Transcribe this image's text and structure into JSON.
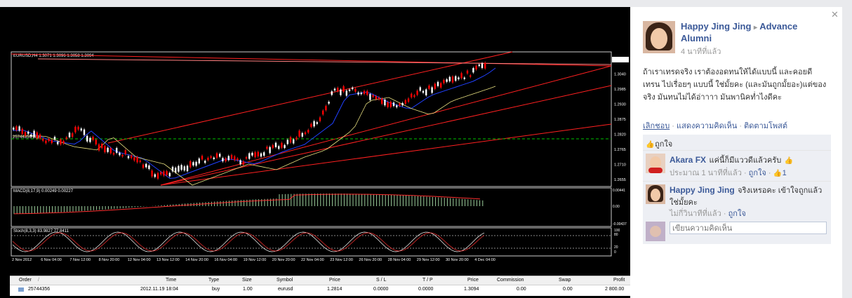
{
  "chart": {
    "symbol_header": "EURUSD,H4  1.3071 1.3096 1.3058 1.3094",
    "position_label": "25744356 buy",
    "macd_header": "MACD(8,17,9) 0.00249 0.00227",
    "stoch_header": "Stoch(8,3,3) 83.9827 77.8411",
    "price_labels": [
      "1.3094",
      "1.3040",
      "1.2985",
      "1.2930",
      "1.2875",
      "1.2820",
      "1.2765",
      "1.2710",
      "1.2655"
    ],
    "macd_labels": [
      "0.00441",
      "0.00",
      "-0.00437"
    ],
    "stoch_labels": [
      "100",
      "80",
      "20",
      "0"
    ],
    "x_labels": [
      "2 Nov 2012",
      "6 Nov 04:00",
      "7 Nov 12:00",
      "8 Nov 20:00",
      "12 Nov 04:00",
      "13 Nov 12:00",
      "14 Nov 20:00",
      "16 Nov 04:00",
      "19 Nov 12:00",
      "20 Nov 20:00",
      "22 Nov 04:00",
      "23 Nov 12:00",
      "26 Nov 20:00",
      "28 Nov 04:00",
      "29 Nov 12:00",
      "30 Nov 20:00",
      "4 Dec 04:00"
    ]
  },
  "terminal": {
    "headers": [
      "Order",
      "/",
      "Time",
      "Type",
      "Size",
      "Symbol",
      "Price",
      "S / L",
      "T / P",
      "Price",
      "Commission",
      "Swap",
      "Profit"
    ],
    "row": [
      "25744356",
      "2012.11.19 18:04",
      "buy",
      "1.00",
      "eurusd",
      "1.2814",
      "0.0000",
      "0.0000",
      "1.3094",
      "0.00",
      "0.00",
      "2 800.00"
    ]
  },
  "post": {
    "author": "Happy Jing Jing",
    "arrow": "▸",
    "group": "Advance Alumni",
    "time": "4 นาทีที่แล้ว",
    "text": "ถ้าเราเทรดจริง เราต้องอดทนให้ได้แบบนี้ และคอยดีเทรน ไปเรื่อยๆ แบบนี้ ใช่มั้ยคะ (และมันถูกมั้ยอะ)แต่ของจริง มันทนไม่ได้อ่าาาา มันพานิคท่ำไงดีคะ",
    "actions": [
      "เลิกชอบ",
      "แสดงความคิดเห็น",
      "ติดตามโพสต์"
    ],
    "separator": "·",
    "like_label": "ถูกใจ"
  },
  "comments": [
    {
      "name": "Akara FX",
      "text": "แค่นี้ก็มีแววดีแล้วครับ",
      "time": "ประมาณ 1 นาทีที่แล้ว",
      "like": "ถูกใจ",
      "likes_count": "1"
    },
    {
      "name": "Happy Jing Jing",
      "text": "จริงเหรอคะ เข้าใจถูกแล้วใช่มั้ยคะ",
      "time": "ไม่กี่วินาทีที่แล้ว",
      "like": "ถูกใจ"
    }
  ],
  "comment_box": {
    "placeholder": "เขียนความคิดเห็น"
  },
  "colors": {
    "link": "#3b5998",
    "candle_up": "#00c000",
    "candle_down": "#ff0000",
    "trend": "#ff2020"
  }
}
